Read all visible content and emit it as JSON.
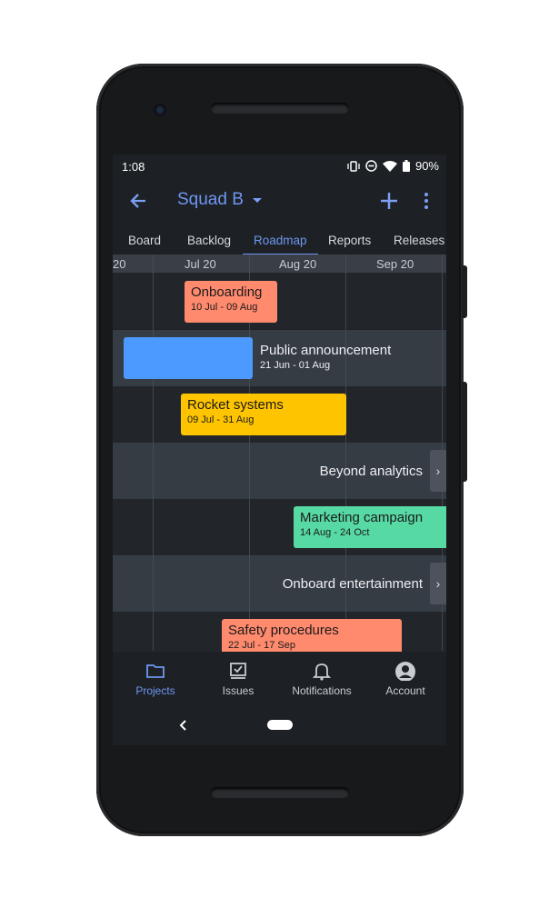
{
  "status_bar": {
    "time": "1:08",
    "battery": "90%"
  },
  "app_bar": {
    "title": "Squad B"
  },
  "tabs": [
    {
      "label": "Board"
    },
    {
      "label": "Backlog"
    },
    {
      "label": "Roadmap"
    },
    {
      "label": "Reports"
    },
    {
      "label": "Releases"
    }
  ],
  "active_tab": "Roadmap",
  "timeline": {
    "labels": [
      "20",
      "Jul 20",
      "Aug 20",
      "Sep 20"
    ]
  },
  "roadmap": [
    {
      "name": "Onboarding",
      "dates": "10 Jul - 09 Aug",
      "color": "#ff8a6e"
    },
    {
      "name": "Public announcement",
      "dates": "21 Jun - 01 Aug",
      "color": "#4c9aff"
    },
    {
      "name": "Rocket systems",
      "dates": "09 Jul - 31 Aug",
      "color": "#ffc400"
    },
    {
      "name": "Beyond analytics",
      "dates": ""
    },
    {
      "name": "Marketing campaign",
      "dates": "14 Aug - 24 Oct",
      "color": "#57d9a3"
    },
    {
      "name": "Onboard entertainment",
      "dates": ""
    },
    {
      "name": "Safety procedures",
      "dates": "22 Jul - 17 Sep",
      "color": "#ff8a6e"
    }
  ],
  "bottom_nav": [
    {
      "label": "Projects",
      "icon": "folder-icon",
      "active": true
    },
    {
      "label": "Issues",
      "icon": "issues-icon"
    },
    {
      "label": "Notifications",
      "icon": "bell-icon"
    },
    {
      "label": "Account",
      "icon": "account-icon"
    }
  ],
  "colors": {
    "accent": "#6f96f2",
    "background": "#1d2125"
  }
}
